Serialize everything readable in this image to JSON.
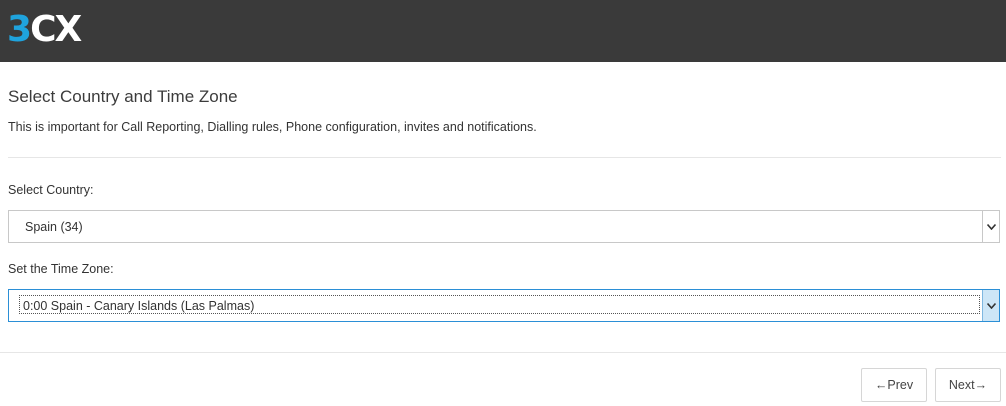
{
  "header": {
    "logo": {
      "part1": "3",
      "part2": "C",
      "part3": "X"
    }
  },
  "main": {
    "title": "Select Country and Time Zone",
    "description": "This is important for Call Reporting, Dialling rules, Phone configuration, invites and notifications.",
    "country": {
      "label": "Select Country:",
      "value": "Spain (34)"
    },
    "timezone": {
      "label": "Set the Time Zone:",
      "value": "0:00 Spain - Canary Islands (Las Palmas)"
    }
  },
  "footer": {
    "prev_label": "←Prev",
    "next_label": "Next→"
  },
  "colors": {
    "header_bg": "#3a3a3a",
    "logo_accent": "#1fa3dd",
    "focus_border": "#2b8fd6"
  }
}
